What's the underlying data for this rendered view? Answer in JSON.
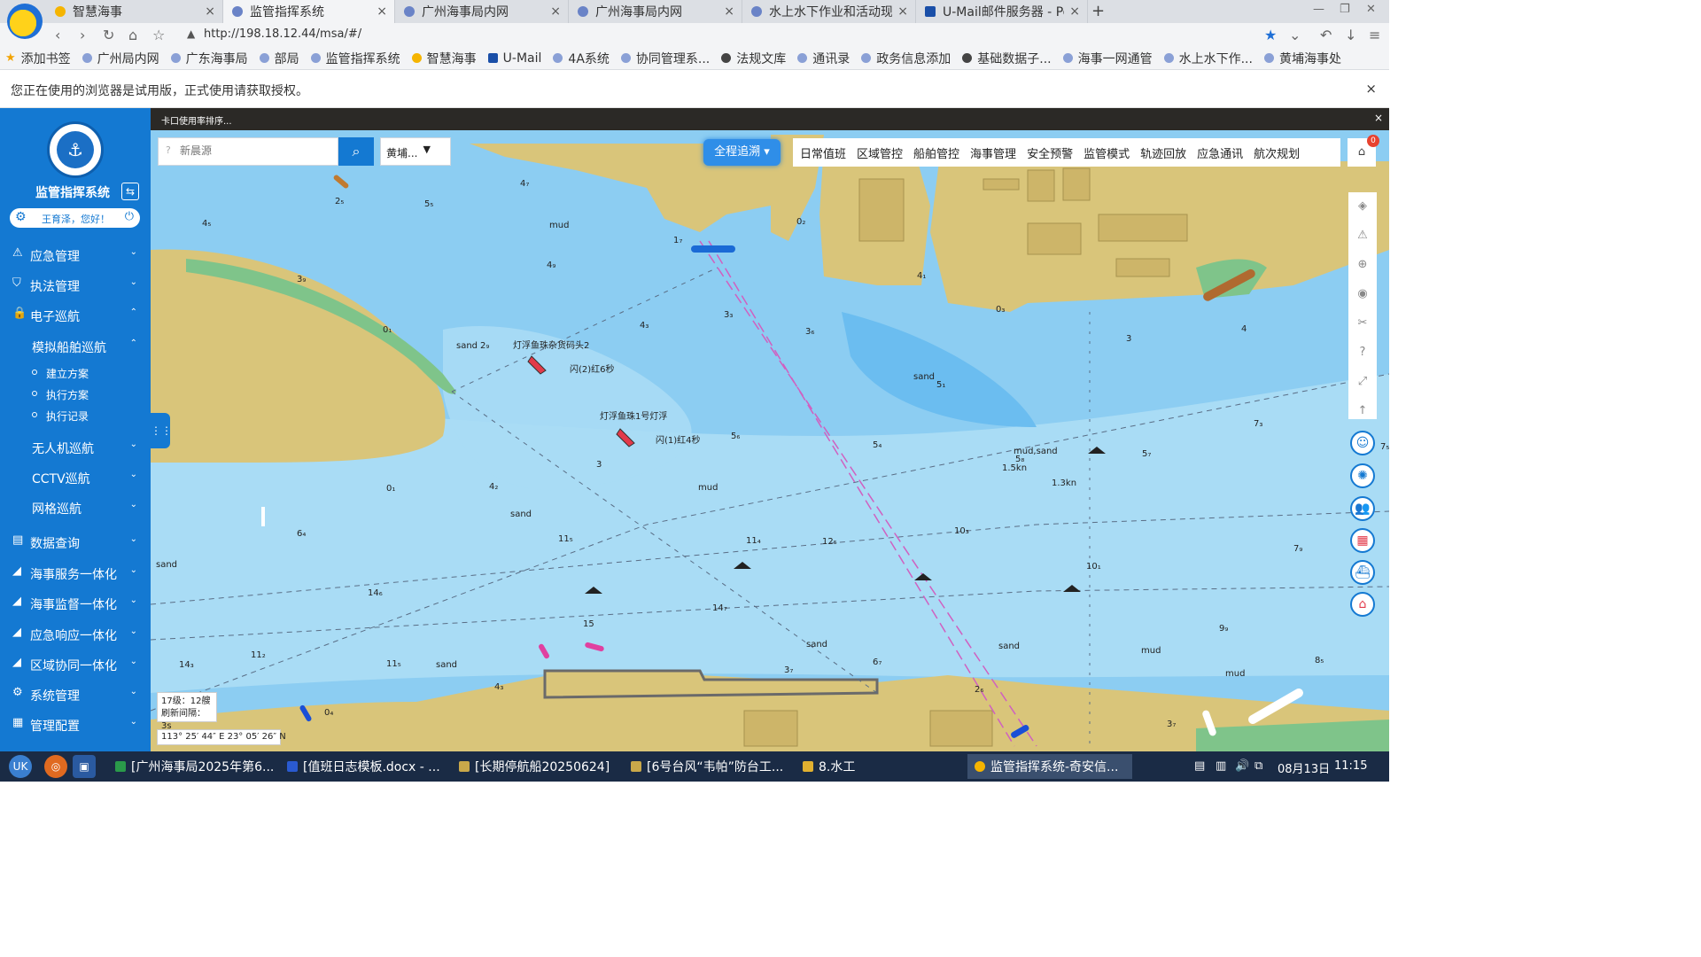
{
  "browser": {
    "tabs": [
      {
        "title": "智慧海事",
        "close": "×"
      },
      {
        "title": "监管指挥系统",
        "close": "×"
      },
      {
        "title": "广州海事局内网",
        "close": "×"
      },
      {
        "title": "广州海事局内网",
        "close": "×"
      },
      {
        "title": "水上水下作业和活动现场",
        "close": "×"
      },
      {
        "title": "U-Mail邮件服务器 - Pow",
        "close": "×"
      }
    ],
    "new_tab": "+",
    "window_controls": [
      "—",
      "❐",
      "✕"
    ],
    "nav_icons": [
      "‹",
      "›",
      "↻",
      "⌂",
      "☆"
    ],
    "address": "http://198.18.12.44/msa/#/",
    "address_warning": "▲",
    "right_icons": [
      "★",
      "⌄",
      "↶",
      "↓",
      "≡"
    ],
    "bookmarks": [
      "添加书签",
      "广州局内网",
      "广东海事局",
      "部局",
      "监管指挥系统",
      "智慧海事",
      "U-Mail",
      "4A系统",
      "协同管理系...",
      "法规文库",
      "通讯录",
      "政务信息添加",
      "基础数据子...",
      "海事一网通管",
      "水上水下作...",
      "黄埔海事处"
    ],
    "notice": "您正在使用的浏览器是试用版，正式使用请获取授权。",
    "notice_close": "×"
  },
  "sidebar": {
    "logo_text": "⚓",
    "title": "监管指挥系统",
    "swap_icon": "⇆",
    "user": {
      "greeting": "王育泽，您好！",
      "gear": "⚙",
      "power": "⏻"
    },
    "menu": [
      {
        "label": "应急管理",
        "icon": "⚠",
        "chev": "⌄"
      },
      {
        "label": "执法管理",
        "icon": "⛉",
        "chev": "⌄"
      },
      {
        "label": "电子巡航",
        "icon": "🔒",
        "chev": "⌃"
      },
      {
        "label": "模拟船舶巡航",
        "chev": "⌃"
      },
      {
        "label": "无人机巡航",
        "chev": "⌄"
      },
      {
        "label": "CCTV巡航",
        "chev": "⌄"
      },
      {
        "label": "网格巡航",
        "chev": "⌄"
      },
      {
        "label": "数据查询",
        "icon": "▤",
        "chev": "⌄"
      },
      {
        "label": "海事服务一体化",
        "icon": "◢",
        "chev": "⌄"
      },
      {
        "label": "海事监督一体化",
        "icon": "◢",
        "chev": "⌄"
      },
      {
        "label": "应急响应一体化",
        "icon": "◢",
        "chev": "⌄"
      },
      {
        "label": "区域协同一体化",
        "icon": "◢",
        "chev": "⌄"
      },
      {
        "label": "系统管理",
        "icon": "⚙",
        "chev": "⌄"
      },
      {
        "label": "管理配置",
        "icon": "▦",
        "chev": "⌄"
      }
    ],
    "leaves": [
      "建立方案",
      "执行方案",
      "执行记录"
    ]
  },
  "map": {
    "top_text": "卡口使用率排序...",
    "top_close": "×",
    "search": {
      "placeholder": "新晨源",
      "hint_icon": "?",
      "button_icon": "⌕"
    },
    "region": {
      "value": "黄埔...",
      "caret": "▼"
    },
    "track_button": "全程追溯 ▾",
    "menu": [
      "日常值班",
      "区域管控",
      "船舶管控",
      "海事管理",
      "安全预警",
      "监管模式",
      "轨迹回放",
      "应急通讯",
      "航次规划"
    ],
    "bell_icon": "⌂",
    "bell_badge": "0",
    "tools": [
      "◈",
      "⚠",
      "⊕",
      "◉",
      "✂",
      "?",
      "⤢",
      "↑"
    ],
    "round_buttons": [
      "☺",
      "✺",
      "👥",
      "▦",
      "⛴",
      "⌂"
    ],
    "collapse_icon": "⋮⋮",
    "zoom_info": {
      "level": "17级：12艘",
      "refresh": "刷新间隔：3s"
    },
    "coords": "113° 25′ 44″ E    23° 05′ 26″ N",
    "labels": [
      {
        "t": "4₇"
      },
      {
        "t": "5₅"
      },
      {
        "t": "4₅"
      },
      {
        "t": "mud"
      },
      {
        "t": "4₉"
      },
      {
        "t": "3₉"
      },
      {
        "t": "2₅"
      },
      {
        "t": "0₁"
      },
      {
        "t": "sand"
      },
      {
        "t": "2₉"
      },
      {
        "t": "灯浮鱼珠杂货码头2"
      },
      {
        "t": "闪(2)红6秒"
      },
      {
        "t": "4₃"
      },
      {
        "t": "3₃"
      },
      {
        "t": "3₆"
      },
      {
        "t": "灯浮鱼珠1号灯浮"
      },
      {
        "t": "闪(1)红4秒"
      },
      {
        "t": "5₆"
      },
      {
        "t": "3"
      },
      {
        "t": "4₂"
      },
      {
        "t": "mud"
      },
      {
        "t": "0₁"
      },
      {
        "t": "sand"
      },
      {
        "t": "6₄"
      },
      {
        "t": "sand"
      },
      {
        "t": "11₅"
      },
      {
        "t": "11₄"
      },
      {
        "t": "12₅"
      },
      {
        "t": "10₃"
      },
      {
        "t": "14₆"
      },
      {
        "t": "14₇"
      },
      {
        "t": "15"
      },
      {
        "t": "14₃"
      },
      {
        "t": "11₂"
      },
      {
        "t": "11₅"
      },
      {
        "t": "sand"
      },
      {
        "t": "4₃"
      },
      {
        "t": "0₄"
      },
      {
        "t": "sand"
      },
      {
        "t": "3₇"
      },
      {
        "t": "6₇"
      },
      {
        "t": "2₆"
      },
      {
        "t": "sand"
      },
      {
        "t": "mud"
      },
      {
        "t": "mud"
      },
      {
        "t": "0₂"
      },
      {
        "t": "4₁"
      },
      {
        "t": "0₃"
      },
      {
        "t": "3"
      },
      {
        "t": "4"
      },
      {
        "t": "sand"
      },
      {
        "t": "5₁"
      },
      {
        "t": "5₄"
      },
      {
        "t": "mud,sand"
      },
      {
        "t": "5₈"
      },
      {
        "t": "1.5kn"
      },
      {
        "t": "1.3kn"
      },
      {
        "t": "5₇"
      },
      {
        "t": "7₃"
      },
      {
        "t": "10₁"
      },
      {
        "t": "7₉"
      },
      {
        "t": "9₉"
      },
      {
        "t": "8₅"
      },
      {
        "t": "3₇"
      },
      {
        "t": "1₇"
      },
      {
        "t": "7₅"
      },
      {
        "t": "0₁"
      }
    ]
  },
  "taskbar": {
    "start": "UK",
    "apps": [
      "◎",
      "▣"
    ],
    "tasks": [
      "[广州海事局2025年第6...",
      "[值班日志模板.docx - ...",
      "[长期停航船20250624]",
      "[6号台风“韦帕”防台工...",
      "8.水工",
      "监管指挥系统-奇安信..."
    ],
    "tray_icons": [
      "▤",
      "▥",
      "🔊",
      "⧉"
    ],
    "date": "08月13日",
    "time": "11:15"
  },
  "colors": {
    "primary": "#1479d2",
    "land": "#d9c57a",
    "deep_water": "#8ccdf2",
    "shallow_water": "#5fb0ee",
    "green_shore": "#7fc48a"
  }
}
